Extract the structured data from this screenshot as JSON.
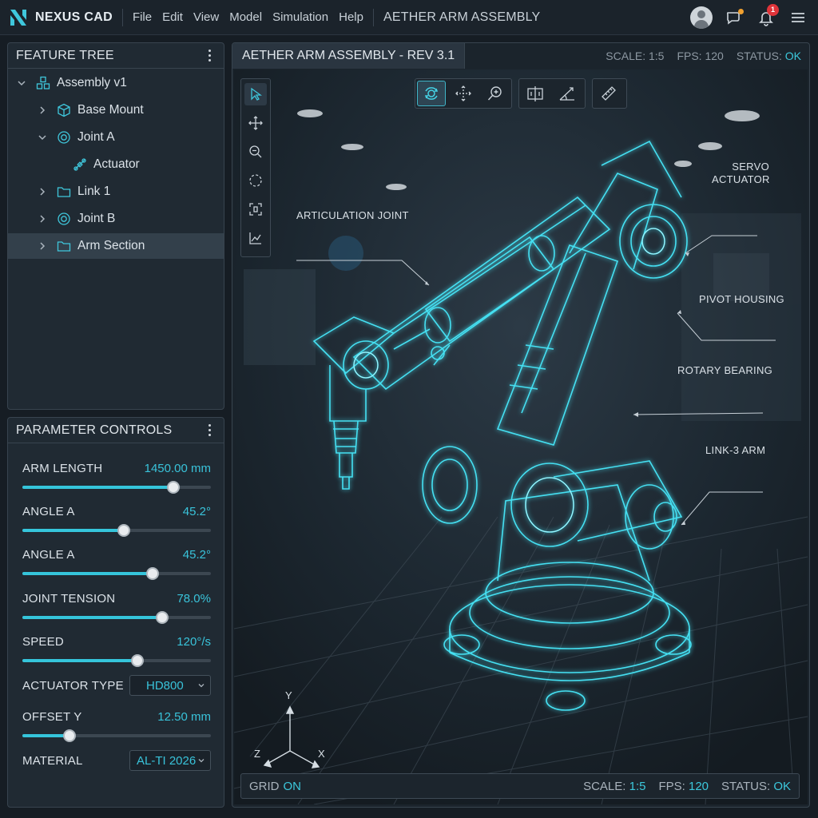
{
  "app": {
    "name": "NEXUS CAD",
    "menu": [
      "File",
      "Edit",
      "View",
      "Model",
      "Simulation",
      "Help"
    ],
    "document_title": "AETHER ARM ASSEMBLY",
    "notification_count": "1"
  },
  "feature_tree": {
    "title": "FEATURE TREE",
    "items": [
      {
        "label": "Assembly v1",
        "icon": "assembly-icon",
        "expanded": true
      },
      {
        "label": "Base Mount",
        "icon": "cube-icon",
        "expanded": false
      },
      {
        "label": "Joint A",
        "icon": "joint-icon",
        "expanded": true
      },
      {
        "label": "Actuator",
        "icon": "actuator-icon"
      },
      {
        "label": "Link 1",
        "icon": "folder-icon",
        "expanded": false
      },
      {
        "label": "Joint B",
        "icon": "joint-icon",
        "expanded": false
      },
      {
        "label": "Arm Section",
        "icon": "folder-icon",
        "expanded": false,
        "selected": true
      }
    ]
  },
  "parameters": {
    "title": "PARAMETER CONTROLS",
    "items": [
      {
        "label": "ARM LENGTH",
        "value": "1450.00 mm",
        "level": 0.8
      },
      {
        "label": "ANGLE A",
        "value": "45.2°",
        "level": 0.54
      },
      {
        "label": "ANGLE A",
        "value": "45.2°",
        "level": 0.69
      },
      {
        "label": "JOINT TENSION",
        "value": "78.0%",
        "level": 0.74
      },
      {
        "label": "SPEED",
        "value": "120°/s",
        "level": 0.61
      },
      {
        "label": "ACTUATOR TYPE",
        "select": "HD800"
      },
      {
        "label": "OFFSET Y",
        "value": "12.50 mm",
        "level": 0.25
      },
      {
        "label": "MATERIAL",
        "select": "AL-TI 2026"
      }
    ]
  },
  "viewport": {
    "tab": "AETHER ARM ASSEMBLY - REV 3.1",
    "scale_label": "SCALE:",
    "scale": "1:5",
    "fps_label": "FPS:",
    "fps": "120",
    "status_label": "STATUS:",
    "status": "OK",
    "callouts": {
      "servo_line1": "SERVO",
      "servo_line2": "ACTUATOR",
      "articulation": "ARTICULATION JOINT",
      "pivot": "PIVOT HOUSING",
      "rotary": "ROTARY BEARING",
      "link3": "LINK-3 ARM"
    },
    "axes": {
      "x": "X",
      "y": "Y",
      "z": "Z"
    },
    "status_bar": {
      "grid_label": "GRID",
      "grid": "ON",
      "scale_label": "SCALE:",
      "scale": "1:5",
      "fps_label": "FPS:",
      "fps": "120",
      "status_label": "STATUS:",
      "status": "OK"
    }
  },
  "colors": {
    "accent": "#35c5db",
    "notification": "#e0343a",
    "chat_dot": "#f0a030"
  }
}
